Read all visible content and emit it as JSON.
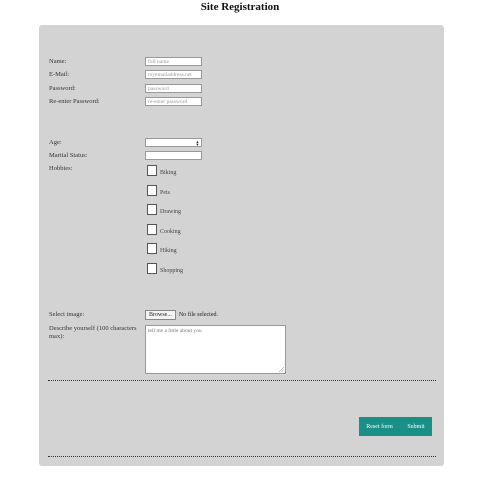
{
  "page": {
    "title": "Site Registration"
  },
  "form": {
    "name_label": "Name:",
    "name_placeholder": "full name",
    "email_label": "E-Mail:",
    "email_placeholder": "myemailaddress.net",
    "password_label": "Password:",
    "password_placeholder": "password",
    "repassword_label": "Re-enter Password:",
    "repassword_placeholder": "re-enter password",
    "age_label": "Age:",
    "marital_label": "Marital Status:",
    "hobbies_label": "Hobbies:",
    "hobbies": [
      "Biking",
      "Pets",
      "Drawing",
      "Cooking",
      "Hiking",
      "Shopping"
    ],
    "image_label": "Select image:",
    "browse_label": "Browse...",
    "file_status": "No file selected.",
    "describe_label": "Describe yourself (100 characters max):",
    "describe_placeholder": "tell me a little about you"
  },
  "actions": {
    "reset_label": "Reset form",
    "submit_label": "Submit"
  },
  "colors": {
    "panel": "#d3d3d3",
    "button": "#1a8f87"
  }
}
